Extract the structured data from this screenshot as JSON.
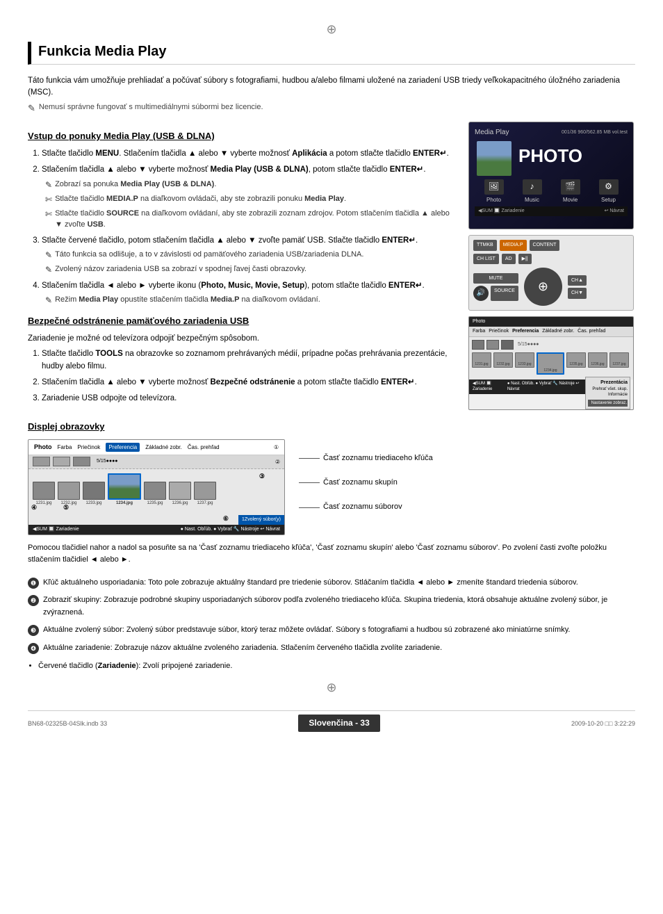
{
  "page": {
    "title": "Funkcia Media Play",
    "crosshair_top": "⊕",
    "crosshair_bottom": "⊕",
    "intro": {
      "text": "Táto funkcia vám umožňuje prehliadať a počúvať súbory s fotografiami, hudbou a/alebo filmami uložené na zariadení USB triedy veľkokapacitného úložného zariadenia (MSC).",
      "note": "Nemusí správne fungovať s multimediálnymi súbormi bez licencie."
    },
    "section1": {
      "title": "Vstup do ponuky Media Play (USB & DLNA)",
      "steps": [
        {
          "text": "Stlačte tlačidlo MENU. Stlačením tlačidla ▲ alebo ▼ vyberte možnosť Aplikácia a potom stlačte tlačidlo ENTER↵.",
          "bold_parts": [
            "MENU",
            "Aplikácia",
            "ENTER↵"
          ]
        },
        {
          "text": "Stlačením tlačidla ▲ alebo ▼ vyberte možnosť Media Play (USB & DLNA), potom stlačte tlačidlo ENTER↵.",
          "bold_parts": [
            "Media Play (USB & DLNA)",
            "ENTER↵"
          ],
          "subnotes": [
            "Zobrazí sa ponuka Media Play (USB & DLNA).",
            "Stlačte tlačidlo MEDIA.P na diaľkovom ovládači, aby ste zobrazili ponuku Media Play.",
            "Stlačte tlačidlo SOURCE na diaľkovom ovládaní, aby ste zobrazili zoznam zdrojov. Potom stlačením tlačidla ▲ alebo ▼ zvoľte USB."
          ]
        },
        {
          "text": "Stlačte červené tlačidlo, potom stlačením tlačidla ▲ alebo ▼ zvoľte pamäť USB. Stlačte tlačidlo ENTER↵.",
          "bold_parts": [
            "ENTER↵"
          ],
          "subnotes": [
            "Táto funkcia sa odlišuje, a to v závislosti od pamäťového zariadenia USB/zariadenia DLNA.",
            "Zvolený názov zariadenia USB sa zobrazí v spodnej ľavej časti obrazovky."
          ]
        },
        {
          "text": "Stlačením tlačidla ◄ alebo ► vyberte ikonu (Photo, Music, Movie, Setup), potom stlačte tlačidlo ENTER↵.",
          "bold_parts": [
            "Photo, Music, Movie, Setup",
            "ENTER↵"
          ],
          "subnotes": [
            "Režim Media Play opustíte stlačením tlačidla Media.P na diaľkovom ovládaní."
          ]
        }
      ]
    },
    "section2": {
      "title": "Bezpečné odstránenie pamäťového zariadenia USB",
      "intro": "Zariadenie je možné od televízora odpojiť bezpečným spôsobom.",
      "steps": [
        "Stlačte tlačidlo TOOLS na obrazovke so zoznamom prehrávaných médií, prípadne počas prehrávania prezentácie, hudby alebo filmu.",
        "Stlačením tlačidla ▲ alebo ▼ vyberte možnosť Bezpečné odstránenie a potom stlačte tlačidlo ENTER↵.",
        "Zariadenie USB odpojte od televízora."
      ]
    },
    "section3": {
      "title": "Displej obrazovky"
    },
    "displej_labels": [
      "Časť zoznamu triediaceho kľúča",
      "Časť zoznamu skupín",
      "Časť zoznamu súborov"
    ],
    "bottom_notes": [
      {
        "num": "❶",
        "text": "Kľúč aktuálneho usporiadania: Toto pole zobrazuje aktuálny štandard pre triedenie súborov. Stláčaním tlačidla ◄ alebo ► zmeníte štandard triedenia súborov."
      },
      {
        "num": "❷",
        "text": "Zobraziť skupiny: Zobrazuje podrobné skupiny usporiadaných súborov podľa zvoleného triediaceho kľúča. Skupina triedenia, ktorá obsahuje aktuálne zvolený súbor, je zvýraznená."
      },
      {
        "num": "❸",
        "text": "Aktuálne zvolený súbor: Zvolený súbor predstavuje súbor, ktorý teraz môžete ovládať. Súbory s fotografiami a hudbou sú zobrazené ako miniatúrne snímky."
      },
      {
        "num": "❹",
        "text": "Aktuálne zariadenie: Zobrazuje názov aktuálne zvoleného zariadenia. Stlačením červeného tlačidla zvolíte zariadenie."
      }
    ],
    "bullet_note": "Červené tlačidlo (Zariadenie): Zvolí pripojené zariadenie.",
    "media_play_screen": {
      "title": "Media Play",
      "big_title": "PHOTO",
      "info": "001/36 960/562.85 MB vol.test",
      "icons": [
        {
          "label": "Photo",
          "symbol": "🖼"
        },
        {
          "label": "Music",
          "symbol": "♪"
        },
        {
          "label": "Movie",
          "symbol": "🎬"
        },
        {
          "label": "Setup",
          "symbol": "⚙"
        }
      ],
      "footer_left": "SUM  Zariadenie",
      "footer_right": "Návrat"
    },
    "remote_buttons": {
      "row1": [
        "TTMKB",
        "MEDIA.P",
        "CONTENT"
      ],
      "row2": [
        "CH LIST",
        "AD",
        "▶||"
      ],
      "mute": "MUTE",
      "source": "SOURCE"
    },
    "photo_browser": {
      "header": "Photo",
      "menu_items": [
        "Farba",
        "Priečinok",
        "Preferencia",
        "Základné zobr.",
        "Čas. prehľad"
      ],
      "footer": "● Nast. Obľúb.  ● Vybrať  🔧 Nástroje  ↩ Návrat"
    },
    "displej_screen": {
      "title": "Photo",
      "menu_items": [
        "Farba",
        "Priečinok",
        "Preferencia",
        "Základné zobr.",
        "Čas. prehľad"
      ],
      "files": [
        "1231.jpg",
        "1232.jpg",
        "1233.jpg",
        "1234.jpg",
        "1235.jpg",
        "1236.jpg",
        "1237.jpg"
      ],
      "selected_count": "1Zvolený súbor(y)",
      "footer": "◀SUM  Zariadenie  ● Nast. Obľúb.  ● Vybrať  🔧 Nástroje  ↩ Návrat"
    },
    "page_number": "Slovenčina - 33",
    "footer": {
      "filename": "BN68-02325B-04Slk.indb   33",
      "date": "2009-10-20     □□ 3:22:29"
    }
  }
}
